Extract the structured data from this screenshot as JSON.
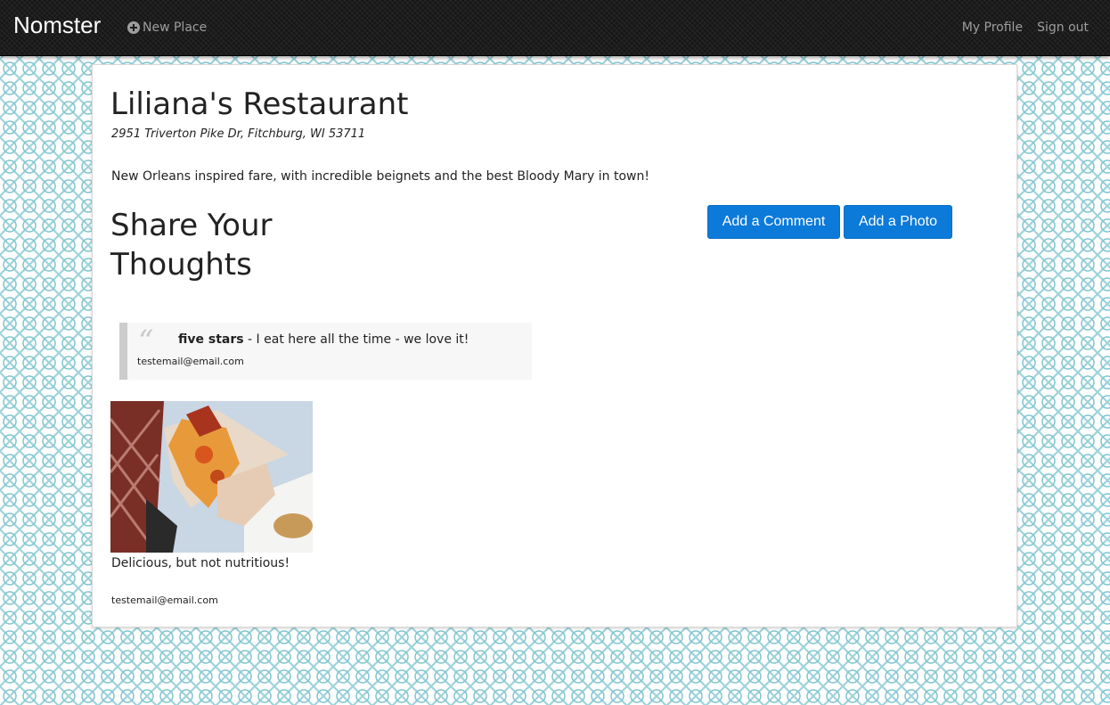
{
  "nav": {
    "brand": "Nomster",
    "new_place": "New Place",
    "my_profile": "My Profile",
    "sign_out": "Sign out"
  },
  "place": {
    "name": "Liliana's Restaurant",
    "address": "2951 Triverton Pike Dr, Fitchburg, WI 53711",
    "description": "New Orleans inspired fare, with incredible beignets and the best Bloody Mary in town!"
  },
  "share": {
    "heading": "Share Your Thoughts",
    "add_comment": "Add a Comment",
    "add_photo": "Add a Photo"
  },
  "comments": [
    {
      "rating": "five stars",
      "separator": " - ",
      "message": "I eat here all the time - we love it!",
      "user": "testemail@email.com"
    }
  ],
  "photos": [
    {
      "caption": "Delicious, but not nutritious!",
      "user": "testemail@email.com"
    }
  ],
  "colors": {
    "accent": "#0b7ad9",
    "navbar": "#1c1c1c"
  }
}
